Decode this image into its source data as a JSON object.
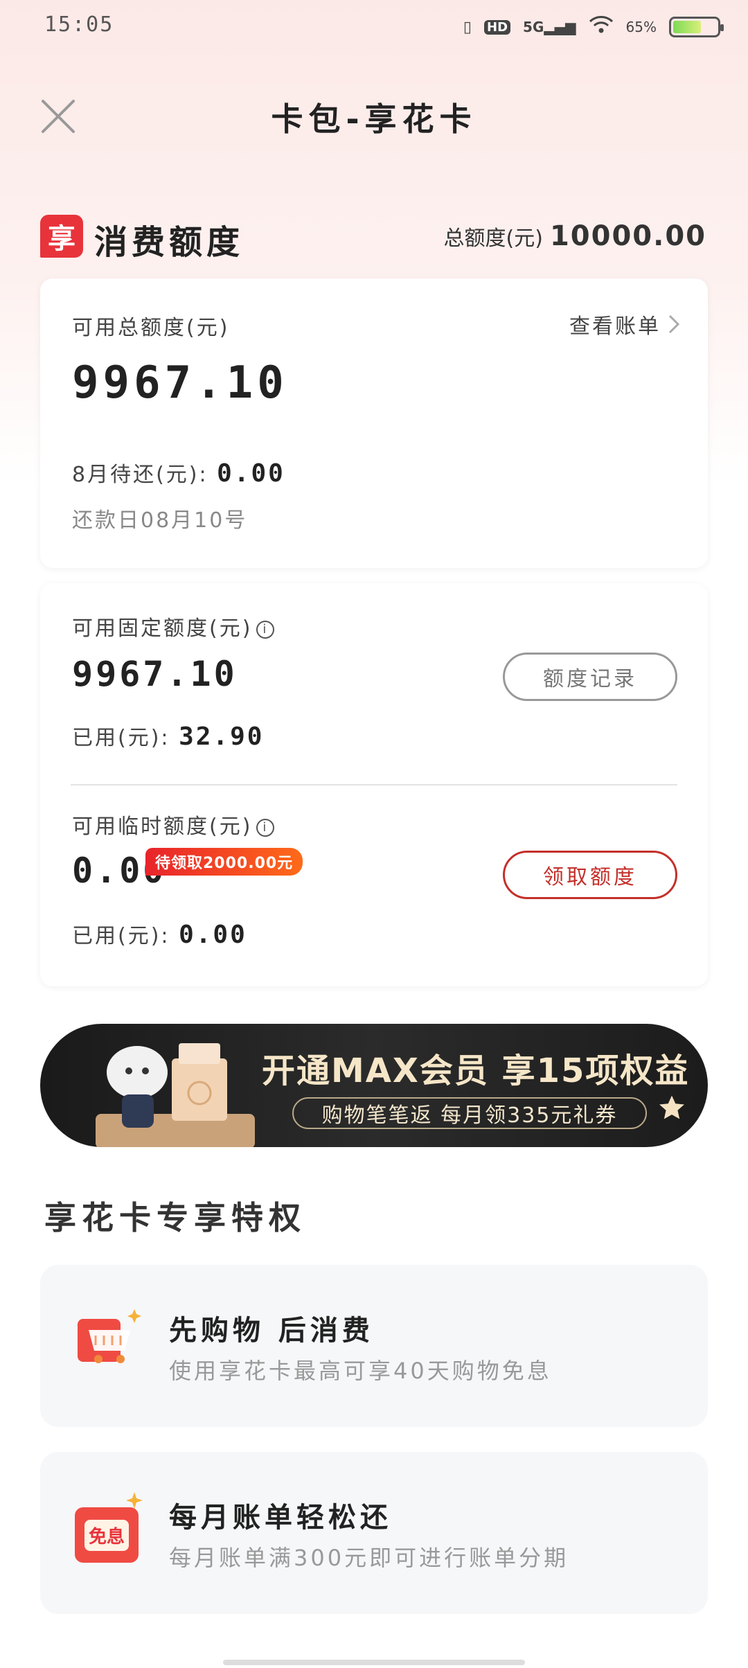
{
  "status_bar": {
    "time": "15:05",
    "network": "5G",
    "hd": "HD",
    "battery": "65%",
    "battery_level": 0.65
  },
  "header": {
    "title": "卡包-享花卡"
  },
  "section": {
    "logo_char": "享",
    "title": "消费额度",
    "total_label": "总额度(元)",
    "total_value": "10000.00"
  },
  "summary_card": {
    "label": "可用总额度(元)",
    "link": "查看账单",
    "amount": "9967.10",
    "due_label": "8月待还(元):",
    "due_value": "0.00",
    "repay_date": "还款日08月10号"
  },
  "fixed": {
    "label": "可用固定额度(元)",
    "amount": "9967.10",
    "button": "额度记录",
    "used_label": "已用(元):",
    "used_value": "32.90"
  },
  "temporary": {
    "label": "可用临时额度(元)",
    "amount": "0.00",
    "tag": "待领取2000.00元",
    "button": "领取额度",
    "used_label": "已用(元):",
    "used_value": "0.00"
  },
  "banner": {
    "title": "开通MAX会员 享15项权益",
    "subtitle": "购物笔笔返 每月领335元礼券"
  },
  "perks": {
    "title": "享花卡专享特权",
    "items": [
      {
        "title": "先购物 后消费",
        "subtitle": "使用享花卡最高可享40天购物免息",
        "icon": "shopping-cart-icon"
      },
      {
        "title": "每月账单轻松还",
        "subtitle": "每月账单满300元即可进行账单分期",
        "icon": "free-interest-icon",
        "icon_text": "免息"
      }
    ]
  },
  "colors": {
    "accent_red": "#e8333b",
    "button_red": "#c4302b"
  }
}
